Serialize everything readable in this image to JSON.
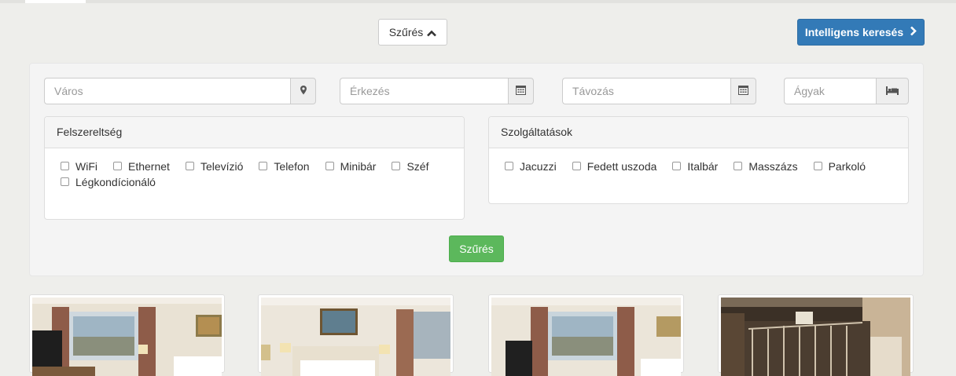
{
  "toolbar": {
    "filter_toggle_label": "Szűrés",
    "smart_search_label": "Intelligens keresés"
  },
  "search": {
    "city_placeholder": "Város",
    "arrival_placeholder": "Érkezés",
    "departure_placeholder": "Távozás",
    "beds_placeholder": "Ágyak"
  },
  "amenities": {
    "title": "Felszereltség",
    "items": [
      "WiFi",
      "Ethernet",
      "Televízió",
      "Telefon",
      "Minibár",
      "Széf",
      "Légkondícionáló"
    ]
  },
  "services": {
    "title": "Szolgáltatások",
    "items": [
      "Jacuzzi",
      "Fedett uszoda",
      "Italbár",
      "Masszázs",
      "Parkoló"
    ]
  },
  "filter_button_label": "Szűrés",
  "icons": {
    "toggle": "chevron-up-icon",
    "smart": "chevron-right-icon",
    "city": "map-marker-icon",
    "arrival": "calendar-icon",
    "departure": "calendar-icon",
    "beds": "bed-icon"
  },
  "colors": {
    "primary": "#337ab7",
    "success": "#5cb85c",
    "background": "#eeeeeb"
  }
}
